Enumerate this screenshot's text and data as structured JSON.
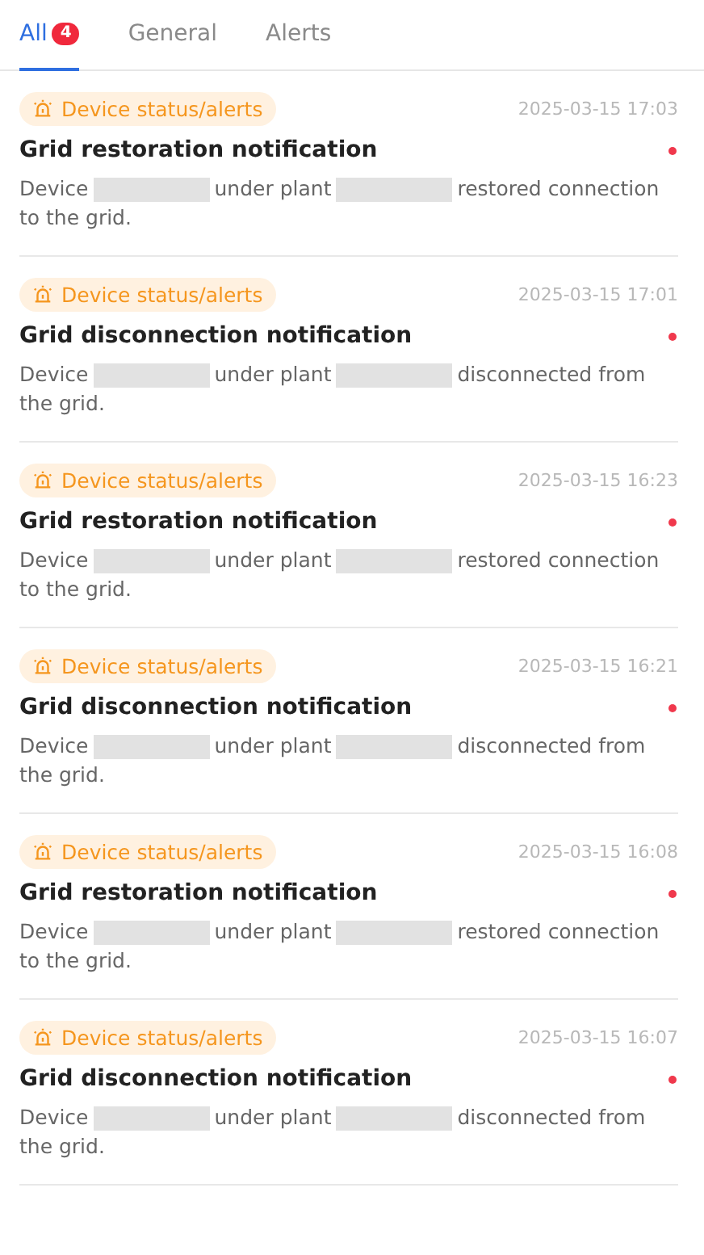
{
  "tabs": [
    {
      "label": "All",
      "badge": "4",
      "selected": true
    },
    {
      "label": "General",
      "selected": false
    },
    {
      "label": "Alerts",
      "selected": false
    }
  ],
  "notifications": [
    {
      "tag": "Device status/alerts",
      "time": "2025-03-15 17:03",
      "title": "Grid restoration notification",
      "unread": true,
      "body_parts": [
        "Device",
        "under plant",
        "restored connection to the grid."
      ]
    },
    {
      "tag": "Device status/alerts",
      "time": "2025-03-15 17:01",
      "title": "Grid disconnection notification",
      "unread": true,
      "body_parts": [
        "Device",
        "under plant",
        "disconnected from the grid."
      ]
    },
    {
      "tag": "Device status/alerts",
      "time": "2025-03-15 16:23",
      "title": "Grid restoration notification",
      "unread": true,
      "body_parts": [
        "Device",
        "under plant",
        "restored connection to the grid."
      ]
    },
    {
      "tag": "Device status/alerts",
      "time": "2025-03-15 16:21",
      "title": "Grid disconnection notification",
      "unread": true,
      "body_parts": [
        "Device",
        "under plant",
        "disconnected from the grid."
      ]
    },
    {
      "tag": "Device status/alerts",
      "time": "2025-03-15 16:08",
      "title": "Grid restoration notification",
      "unread": true,
      "body_parts": [
        "Device",
        "under plant",
        "restored connection to the grid."
      ]
    },
    {
      "tag": "Device status/alerts",
      "time": "2025-03-15 16:07",
      "title": "Grid disconnection notification",
      "unread": true,
      "body_parts": [
        "Device",
        "under plant",
        "disconnected from the grid."
      ]
    }
  ]
}
